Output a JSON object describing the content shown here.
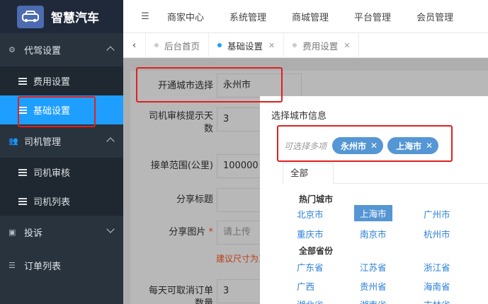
{
  "app": {
    "title": "智慧汽车"
  },
  "sidebar": {
    "groups": [
      {
        "label": "代驾设置",
        "items": [
          "费用设置",
          "基础设置"
        ]
      },
      {
        "label": "司机管理",
        "items": [
          "司机审核",
          "司机列表"
        ]
      },
      {
        "label": "投诉",
        "items": []
      },
      {
        "label": "订单列表",
        "items": []
      }
    ]
  },
  "topnav": [
    "商家中心",
    "系统管理",
    "商城管理",
    "平台管理",
    "会员管理"
  ],
  "tabs": [
    "后台首页",
    "基础设置",
    "费用设置"
  ],
  "form": {
    "fields": [
      {
        "label": "开通城市选择",
        "value": "永州市"
      },
      {
        "label_line1": "司机审核提示天",
        "label_line2": "数",
        "value": "3"
      },
      {
        "label": "接单范围(公里)",
        "value": "100000"
      },
      {
        "label": "分享标题",
        "value": ""
      },
      {
        "label": "分享图片",
        "value": "请上传"
      },
      {
        "label_line1": "每天可取消订单",
        "label_line2": "数量",
        "value": "3"
      }
    ],
    "hint": "建议尺寸为正"
  },
  "modal": {
    "title": "选择城市信息",
    "placeholder": "可选择多项",
    "selected_tags": [
      "永州市",
      "上海市"
    ],
    "tab": "全部",
    "hot_title": "热门城市",
    "hot_cities": [
      "北京市",
      "上海市",
      "广州市",
      "重庆市",
      "南京市",
      "杭州市"
    ],
    "province_title": "全部省份",
    "provinces": [
      "广东省",
      "江苏省",
      "浙江省",
      "广西",
      "贵州省",
      "海南省",
      "湖北省",
      "湖南省",
      "吉林省"
    ]
  },
  "colors": {
    "accent": "#1e9fff",
    "tag": "#5596d4",
    "annotation": "#e02020"
  }
}
